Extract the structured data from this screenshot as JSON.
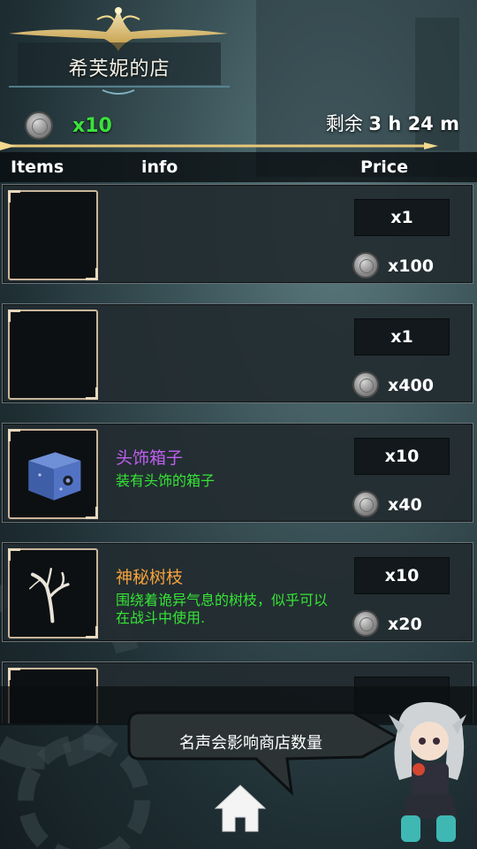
{
  "header": {
    "shop_title": "希芙妮的店",
    "currency_icon": "silver-coin-icon",
    "currency_count": "x10",
    "timer_label": "剩余",
    "timer_value": "3 h 24 m"
  },
  "columns": {
    "items": "Items",
    "info": "info",
    "price": "Price"
  },
  "items": [
    {
      "name": "",
      "desc": "",
      "qty": "x1",
      "price": "x100",
      "icon": "empty-slot"
    },
    {
      "name": "",
      "desc": "",
      "qty": "x1",
      "price": "x400",
      "icon": "empty-slot"
    },
    {
      "name": "头饰箱子",
      "desc": "装有头饰的箱子",
      "qty": "x10",
      "price": "x40",
      "icon": "blue-box-icon",
      "name_color": "#c05ef0"
    },
    {
      "name": "神秘树枝",
      "desc": "围绕着诡异气息的树枝，似乎可以在战斗中使用.",
      "qty": "x10",
      "price": "x20",
      "icon": "white-branch-icon",
      "name_color": "#f5a23a"
    }
  ],
  "footer": {
    "speech": "名声会影响商店数量",
    "home_icon": "home-icon",
    "npc": "shopkeeper-girl"
  },
  "colors": {
    "accent_gold": "#e8c77a",
    "currency_green": "#3be23b",
    "desc_green": "#35e535"
  }
}
